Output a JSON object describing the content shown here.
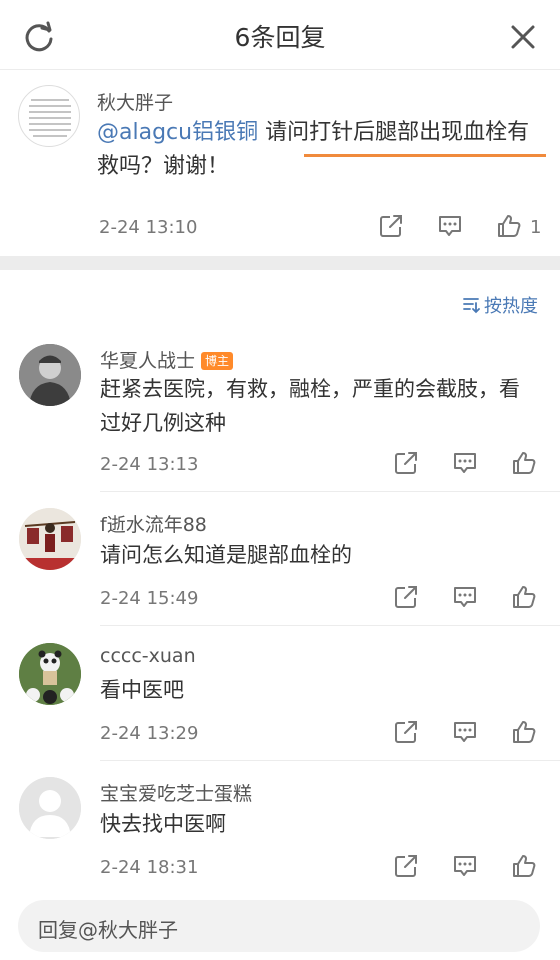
{
  "header": {
    "title": "6条回复",
    "refresh_icon": "refresh-icon",
    "close_icon": "close-icon"
  },
  "root": {
    "username": "秋大胖子",
    "mention": "@alagcu铝银铜",
    "text": " 请问打针后腿部出现血栓有救吗？谢谢！",
    "time": "2-24 13:10",
    "like_count": "1"
  },
  "sort": {
    "label": "按热度",
    "icon": "sort-icon"
  },
  "replies": [
    {
      "username": "华夏人战士",
      "badge": "博主",
      "text": "赶紧去医院，有救，融栓，严重的会截肢，看过好几例这种",
      "time": "2-24 13:13"
    },
    {
      "username": "f逝水流年88",
      "text": "请问怎么知道是腿部血栓的",
      "time": "2-24 15:49"
    },
    {
      "username": "cccc-xuan",
      "text": "看中医吧",
      "time": "2-24 13:29"
    },
    {
      "username": "宝宝爱吃芝士蛋糕",
      "text": "快去找中医啊",
      "time": "2-24 18:31"
    }
  ],
  "input": {
    "placeholder": "回复@秋大胖子"
  },
  "colors": {
    "link": "#4a79b5",
    "highlight_underline": "#f08a3c",
    "badge": "#ff8a2a"
  }
}
